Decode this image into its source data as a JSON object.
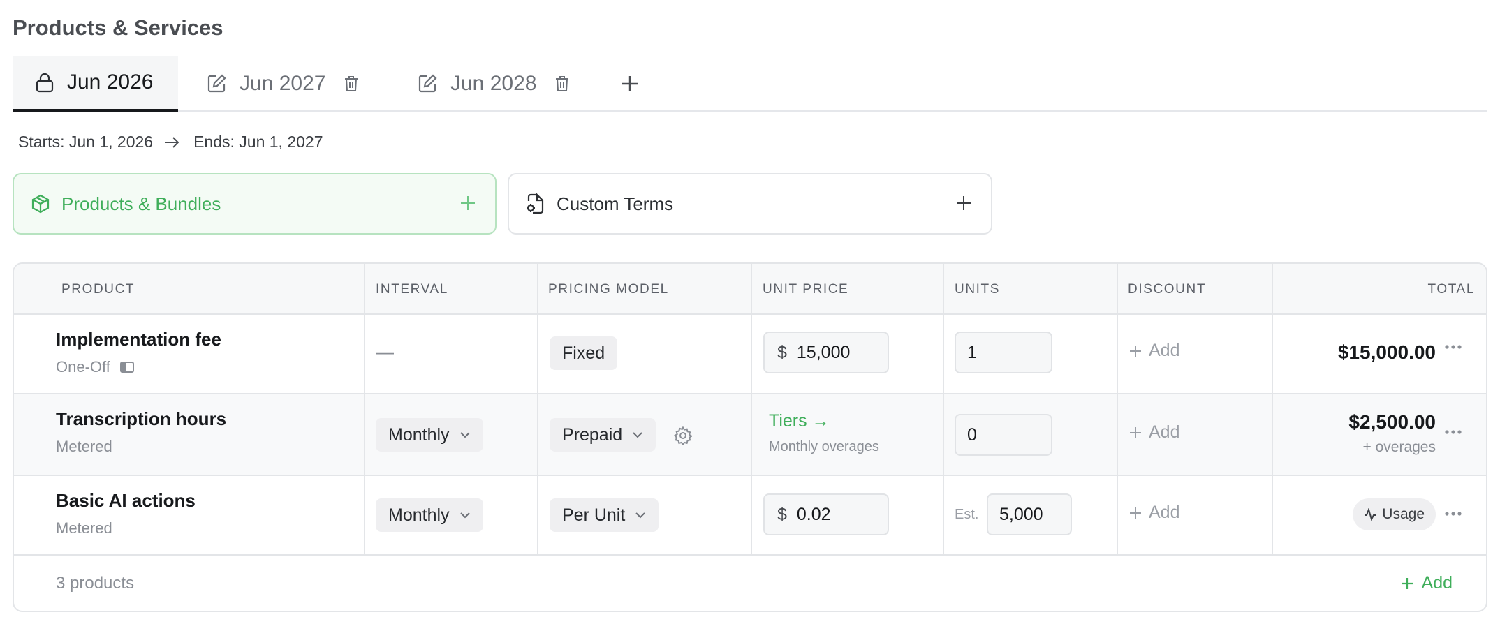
{
  "page": {
    "title": "Products & Services"
  },
  "tabs": [
    {
      "label": "Jun 2026",
      "icon": "lock-icon",
      "active": true
    },
    {
      "label": "Jun 2027",
      "icon": "edit-icon",
      "active": false
    },
    {
      "label": "Jun 2028",
      "icon": "edit-icon",
      "active": false
    }
  ],
  "period": {
    "starts": "Starts: Jun 1, 2026",
    "ends": "Ends: Jun 1, 2027"
  },
  "cards": {
    "products": {
      "label": "Products & Bundles",
      "icon": "package-icon"
    },
    "terms": {
      "label": "Custom Terms",
      "icon": "file-settings-icon"
    }
  },
  "table": {
    "headers": {
      "product": "PRODUCT",
      "interval": "INTERVAL",
      "pricing_model": "PRICING MODEL",
      "unit_price": "UNIT PRICE",
      "units": "UNITS",
      "discount": "DISCOUNT",
      "total": "TOTAL"
    },
    "rows": [
      {
        "name": "Implementation fee",
        "type": "One-Off",
        "interval": "—",
        "pricing_model": "Fixed",
        "currency": "$",
        "unit_price": "15,000",
        "units": "1",
        "discount": "Add",
        "total": "$15,000.00"
      },
      {
        "name": "Transcription hours",
        "type": "Metered",
        "interval": "Monthly",
        "pricing_model": "Prepaid",
        "tiers_link": "Tiers →",
        "tiers_sub": "Monthly overages",
        "units": "0",
        "discount": "Add",
        "total": "$2,500.00",
        "total_sub": "+ overages"
      },
      {
        "name": "Basic AI actions",
        "type": "Metered",
        "interval": "Monthly",
        "pricing_model": "Per Unit",
        "currency": "$",
        "unit_price": "0.02",
        "units_prefix": "Est.",
        "units": "5,000",
        "discount": "Add",
        "total_badge": "Usage"
      }
    ],
    "footer": {
      "count": "3 products",
      "add": "Add"
    }
  },
  "colors": {
    "accent": "#3fae5a",
    "border": "#e3e5e8",
    "text": "#17191c"
  }
}
